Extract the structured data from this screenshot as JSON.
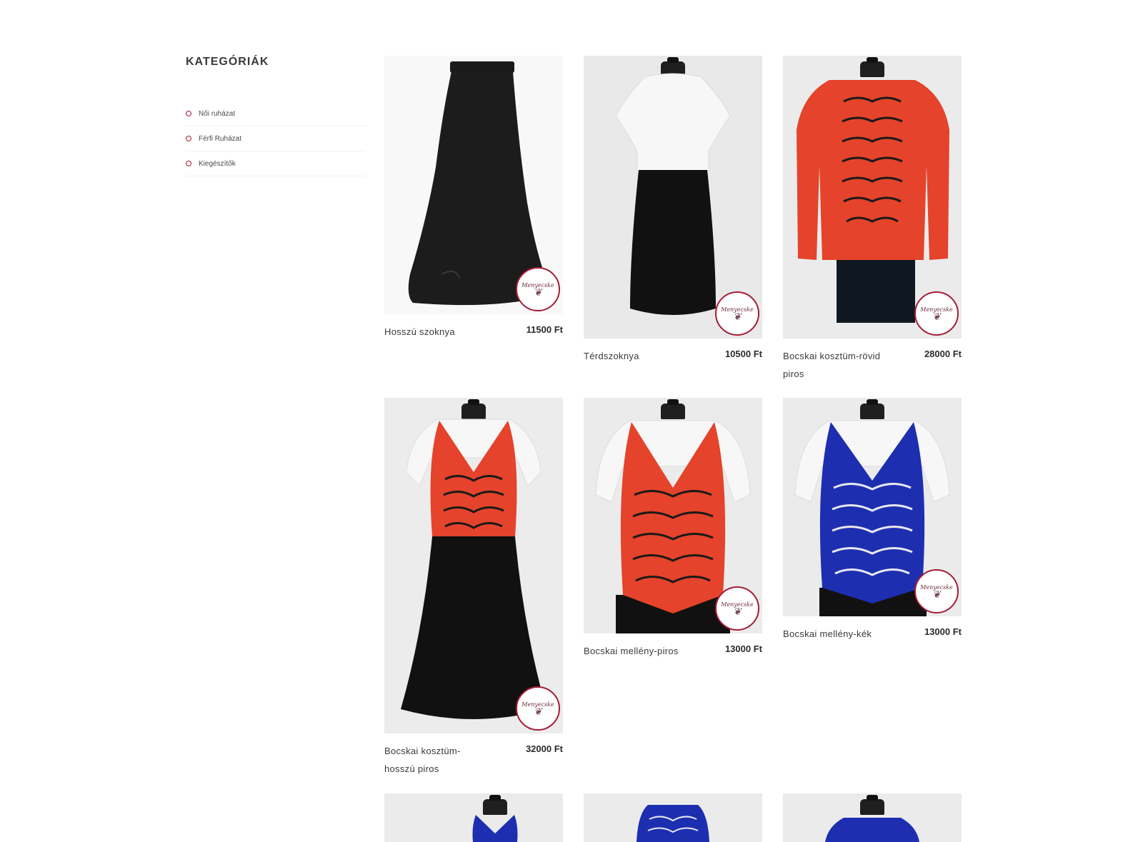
{
  "sidebar": {
    "title": "KATEGÓRIÁK",
    "items": [
      {
        "label": "Női ruházat"
      },
      {
        "label": "Férfi Ruházat"
      },
      {
        "label": "Kiegészítők"
      }
    ]
  },
  "logo_text": "Menyecske",
  "products": [
    {
      "name": "Hosszú szoknya",
      "price": "11500 Ft",
      "icon": "long-black-skirt"
    },
    {
      "name": "Térdszoknya",
      "price": "10500 Ft",
      "icon": "black-pencil-skirt"
    },
    {
      "name": "Bocskai kosztüm-rövid piros",
      "price": "28000 Ft",
      "icon": "red-bocskai-jacket"
    },
    {
      "name": "Bocskai kosztüm-hosszú piros",
      "price": "32000 Ft",
      "icon": "red-vest-long-skirt"
    },
    {
      "name": "Bocskai mellény-piros",
      "price": "13000 Ft",
      "icon": "red-bocskai-vest"
    },
    {
      "name": "Bocskai mellény-kék",
      "price": "13000 Ft",
      "icon": "blue-bocskai-vest"
    }
  ],
  "colors": {
    "accent": "#a41d37",
    "red": "#e8432c",
    "blue": "#1d2fb0",
    "black": "#111111"
  }
}
